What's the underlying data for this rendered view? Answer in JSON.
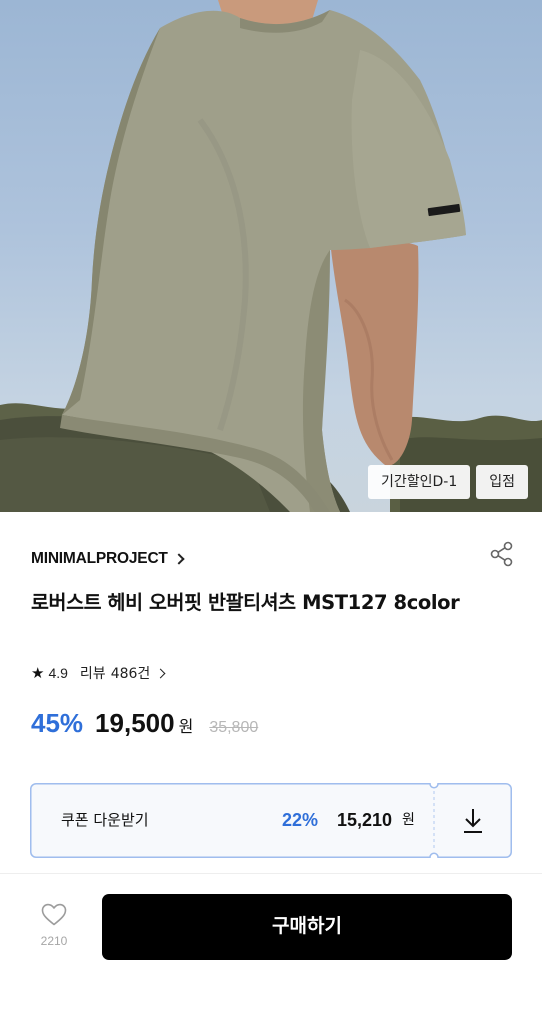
{
  "hero": {
    "image": "man-wearing-khaki-oversized-tshirt-photo",
    "badges": [
      "기간할인D-1",
      "입점"
    ]
  },
  "product": {
    "brand": "MINIMALPROJECT",
    "title": "로버스트 헤비 오버핏 반팔티셔츠 MST127 8color",
    "rating": "4.9",
    "review_label": "리뷰",
    "review_count": "486건",
    "discount": "45%",
    "price": "19,500",
    "price_unit": "원",
    "original_price": "35,800"
  },
  "coupon": {
    "label": "쿠폰 다운받기",
    "rate": "22%",
    "price": "15,210",
    "unit": "원"
  },
  "bottom": {
    "like_count": "2210",
    "buy_label": "구매하기"
  },
  "icons": {
    "share": "share-icon",
    "star": "star-icon",
    "download": "download-icon",
    "heart": "heart-icon"
  },
  "colors": {
    "accent": "#2f6fd9",
    "buy_button": "#000000",
    "muted": "#b7b7b7"
  }
}
